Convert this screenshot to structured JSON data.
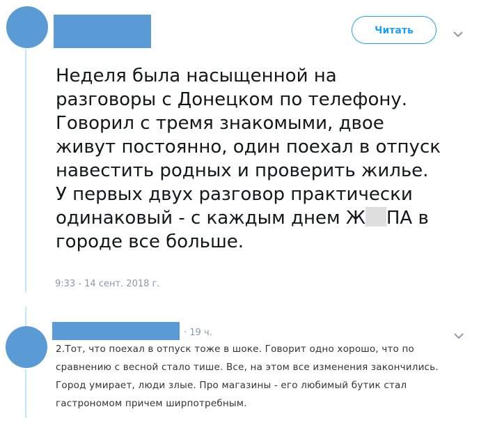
{
  "tweet": {
    "follow_label": "Читать",
    "text_before": "Неделя была насыщенной на\nразговоры с Донецком по телефону.\nГоворил с тремя знакомыми, двое\nживут постоянно, один поехал в отпуск\nнавестить родных и проверить жилье.\nУ первых двух разговор практически\nодинаковый - с каждым днем Ж",
    "text_after": "ПА в\nгороде все больше.",
    "timestamp": "9:33 - 14 сент. 2018 г."
  },
  "reply": {
    "time": "· 19 ч.",
    "text": "2.Тот, что поехал в отпуск тоже в шоке. Говорит одно хорошо, что по\nсравнению с весной стало тише. Все, на этом все изменения закончились.\nГород умирает, люди злые. Про магазины - его любимый бутик стал\nгастрономом причем ширпотребным."
  },
  "colors": {
    "avatar": "#5b9bd5",
    "accent": "#1da1f2",
    "thread_line": "#c4e6fa",
    "meta_text": "#8a9aa8"
  },
  "icons": [
    "chevron-down-icon"
  ]
}
